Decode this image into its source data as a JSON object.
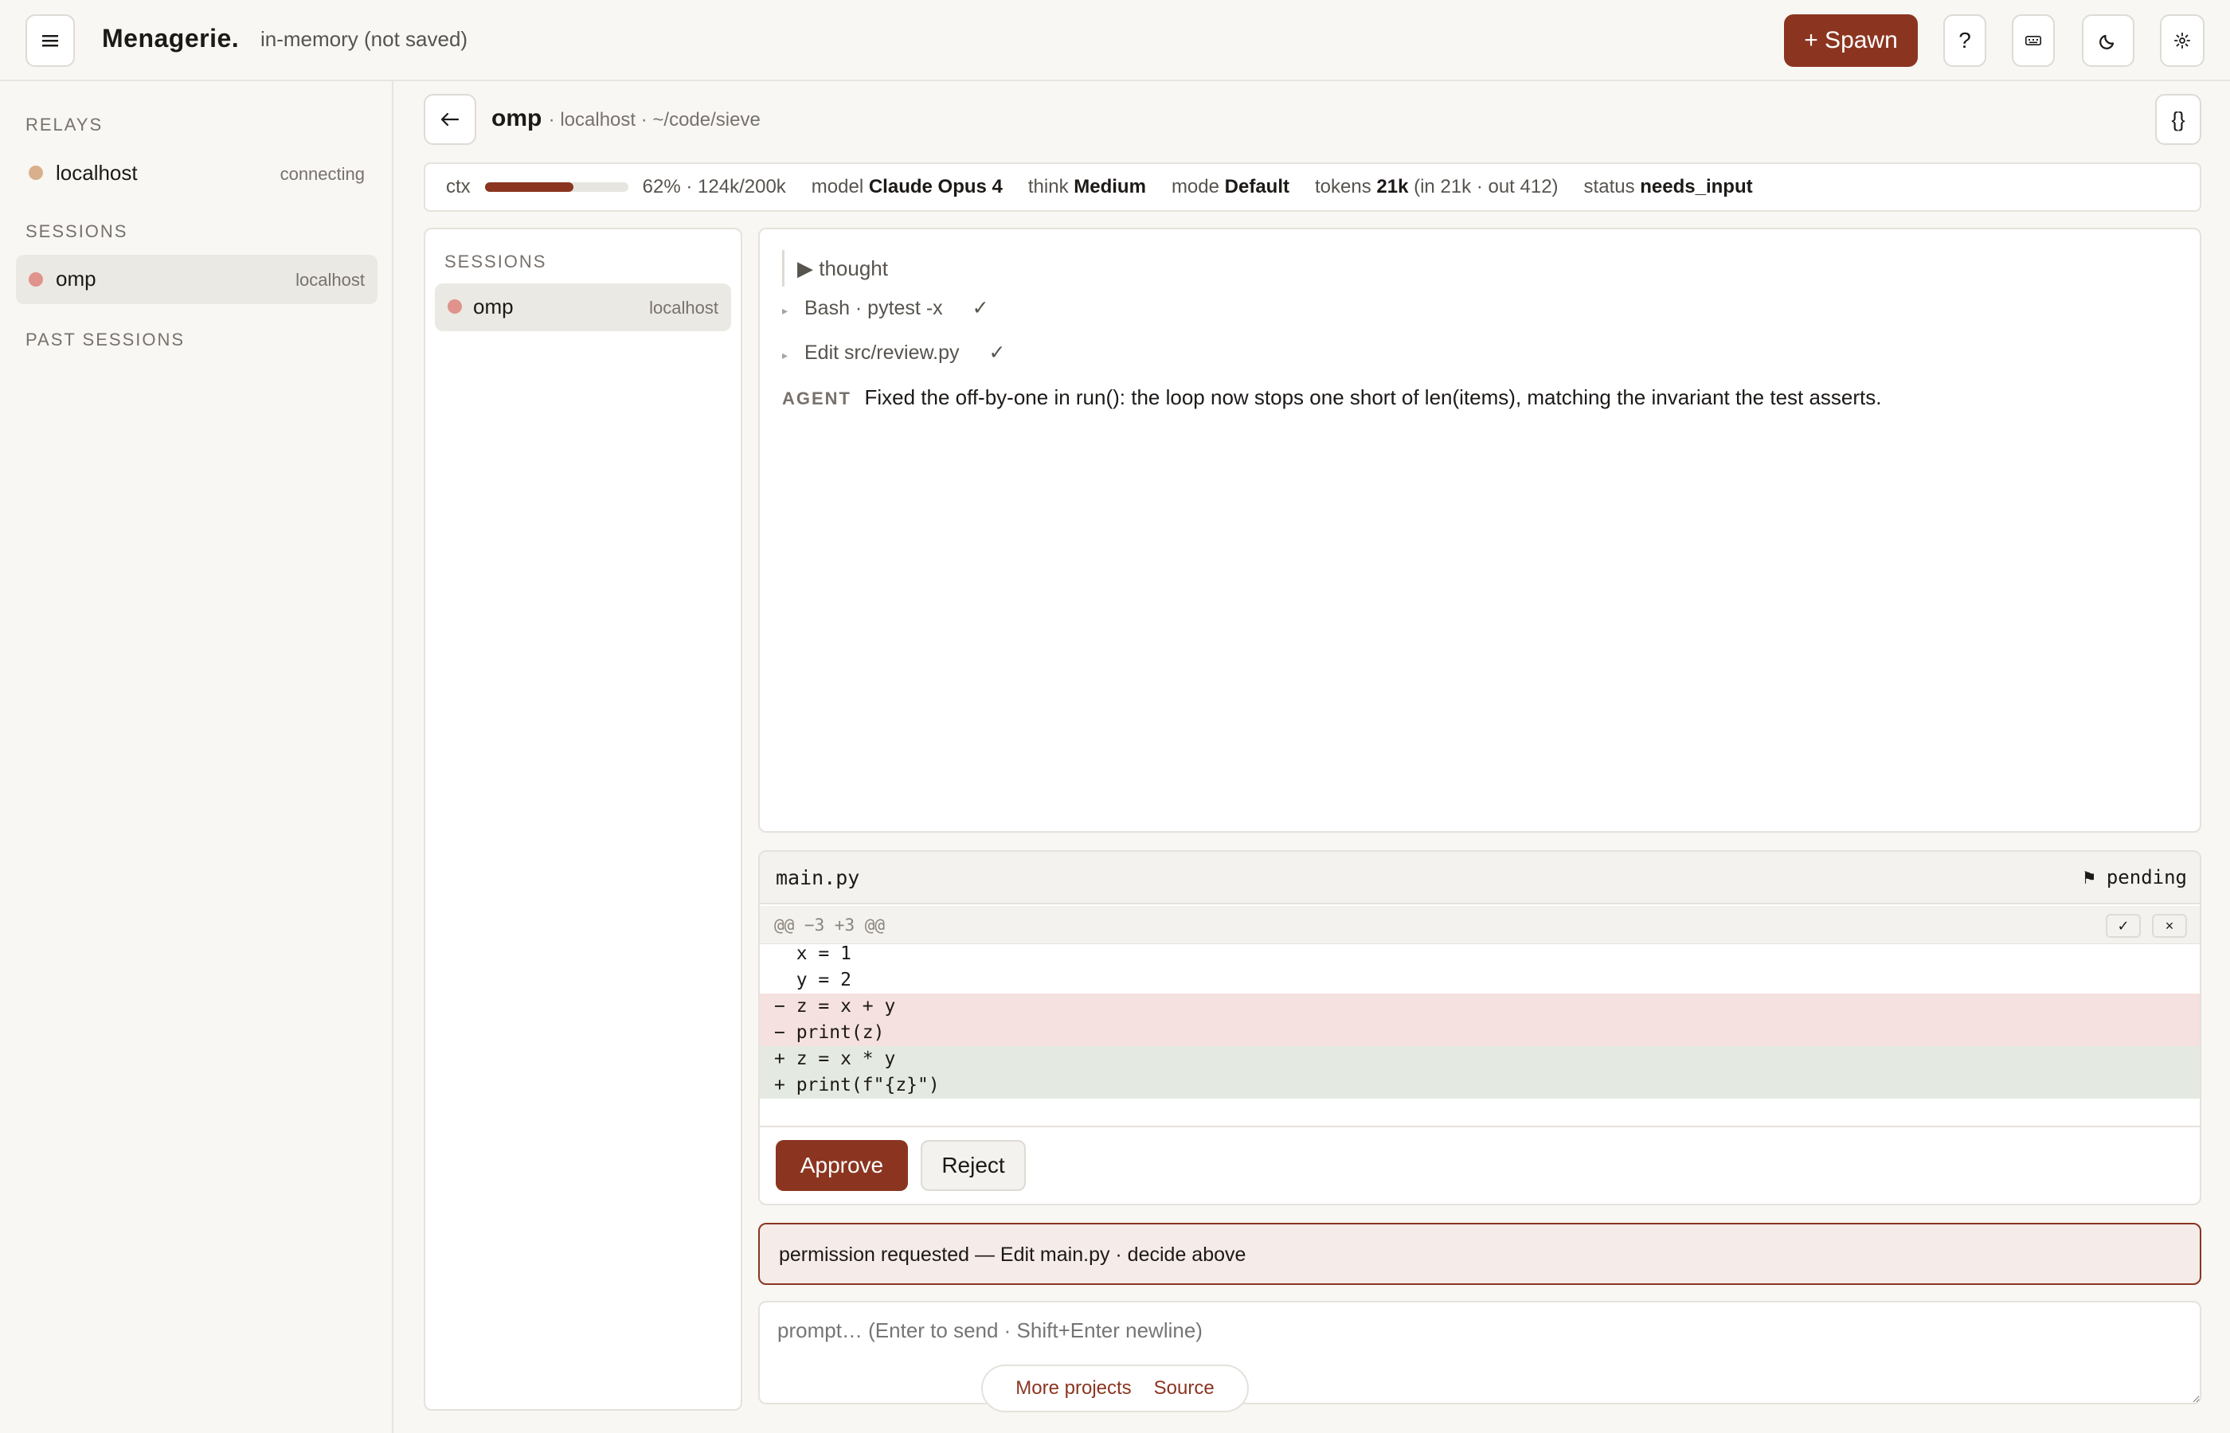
{
  "app": {
    "brand": "Menagerie.",
    "storage_note": "in-memory (not saved)",
    "spawn_label": "+ Spawn",
    "help_label": "?"
  },
  "sidebar": {
    "relays_label": "RELAYS",
    "relays": [
      {
        "name": "localhost",
        "status": "connecting"
      }
    ],
    "sessions_label": "SESSIONS",
    "sessions": [
      {
        "name": "omp",
        "host": "localhost"
      }
    ],
    "past_label": "PAST SESSIONS"
  },
  "session": {
    "name": "omp",
    "path": "· localhost · ~/code/sieve",
    "json_label": "{}"
  },
  "stats": {
    "ctx_label": "ctx",
    "ctx_fraction": 0.62,
    "ctx_text": "62% · 124k/200k",
    "model_label": "model",
    "model_value": "Claude Opus 4",
    "think_label": "think",
    "think_value": "Medium",
    "mode_label": "mode",
    "mode_value": "Default",
    "tokens_label": "tokens",
    "tokens_value": "21k",
    "tokens_detail": "(in 21k · out 412)",
    "status_label": "status",
    "status_value": "needs_input"
  },
  "inner_sessions": {
    "label": "SESSIONS",
    "items": [
      {
        "name": "omp",
        "host": "localhost"
      }
    ]
  },
  "transcript": {
    "thought_label": "▶ thought",
    "tools": [
      {
        "text": "Bash · pytest -x",
        "check": "✓"
      },
      {
        "text": "Edit src/review.py",
        "check": "✓"
      }
    ],
    "agent_tag": "AGENT",
    "agent_message": "Fixed the off-by-one in run(): the loop now stops one short of len(items), matching the invariant the test asserts."
  },
  "diff": {
    "file": "main.py",
    "state": "⚑ pending",
    "hunk": "@@ −3 +3 @@",
    "accept_label": "✓",
    "reject_label": "×",
    "lines": [
      {
        "type": "ctx",
        "text": "  x = 1"
      },
      {
        "type": "ctx",
        "text": "  y = 2"
      },
      {
        "type": "del",
        "text": "− z = x + y"
      },
      {
        "type": "del",
        "text": "− print(z)"
      },
      {
        "type": "add",
        "text": "+ z = x * y"
      },
      {
        "type": "add",
        "text": "+ print(f\"{z}\")"
      }
    ],
    "approve_label": "Approve",
    "reject_btn_label": "Reject"
  },
  "permission": {
    "text": "permission requested — Edit main.py · decide above"
  },
  "prompt": {
    "placeholder": "prompt… (Enter to send · Shift+Enter newline)"
  },
  "footer": {
    "more_projects": "More projects",
    "source": "Source"
  },
  "colors": {
    "accent": "#8b3520",
    "relay_dot": "#d9b08c",
    "session_dot": "#e0938c"
  }
}
